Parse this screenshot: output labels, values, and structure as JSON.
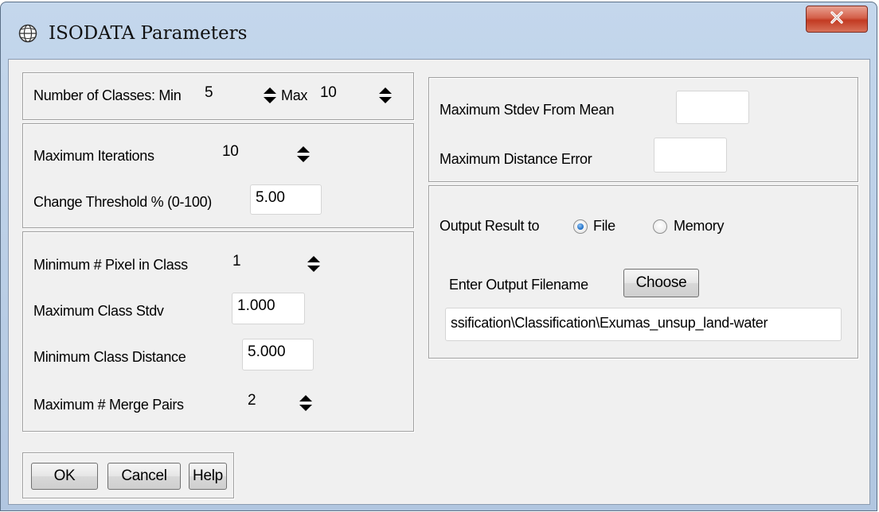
{
  "window": {
    "title": "ISODATA Parameters",
    "icon": "app-globe-icon",
    "close_icon": "close-x-icon"
  },
  "classes": {
    "label_prefix": "Number of Classes: Min",
    "min_value": "5",
    "label_max": "Max",
    "max_value": "10"
  },
  "iterations": {
    "max_iterations_label": "Maximum Iterations",
    "max_iterations_value": "10",
    "change_threshold_label": "Change Threshold % (0-100)",
    "change_threshold_value": "5.00"
  },
  "class_params": {
    "min_pixel_label": "Minimum # Pixel in Class",
    "min_pixel_value": "1",
    "max_class_stdv_label": "Maximum Class Stdv",
    "max_class_stdv_value": "1.000",
    "min_class_distance_label": "Minimum Class Distance",
    "min_class_distance_value": "5.000",
    "max_merge_pairs_label": "Maximum # Merge Pairs",
    "max_merge_pairs_value": "2"
  },
  "stdev": {
    "max_stdev_label": "Maximum Stdev From Mean",
    "max_stdev_value": "",
    "max_distance_error_label": "Maximum Distance Error",
    "max_distance_error_value": ""
  },
  "output": {
    "result_label": "Output Result to",
    "option_file": "File",
    "option_memory": "Memory",
    "selected": "File",
    "filename_label": "Enter Output Filename",
    "choose_button": "Choose",
    "filename_value": "ssification\\Classification\\Exumas_unsup_land-water"
  },
  "buttons": {
    "ok": "OK",
    "cancel": "Cancel",
    "help": "Help"
  },
  "colors": {
    "frame": "#b9cde5",
    "client": "#f0f0f0",
    "close_button": "#c23a22",
    "radio_selected": "#1a6bc4"
  }
}
